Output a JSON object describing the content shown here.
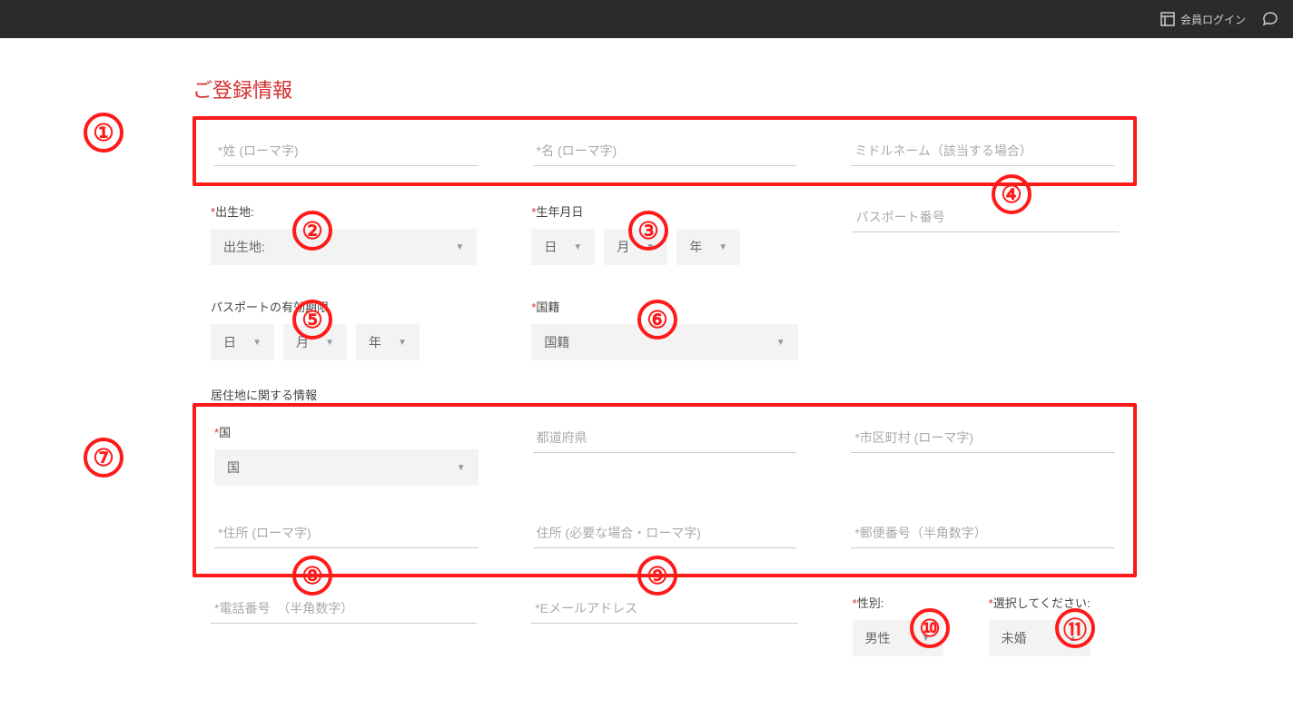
{
  "header": {
    "login_label": "会員ログイン"
  },
  "title": "ご登録情報",
  "fields": {
    "surname_ph": "*姓 (ローマ字)",
    "given_ph": "*名 (ローマ字)",
    "middle_ph": "ミドルネーム（該当する場合）",
    "birthplace_label": "出生地:",
    "birthplace_ph": "出生地:",
    "dob_label": "生年月日",
    "day": "日",
    "month": "月",
    "year": "年",
    "passport_ph": "パスポート番号",
    "passport_exp_label": "パスポートの有効期限",
    "nationality_label": "国籍",
    "nationality_ph": "国籍",
    "residence_heading": "居住地に関する情報",
    "country_label": "国",
    "country_ph": "国",
    "prefecture_ph": "都道府県",
    "city_ph": "*市区町村 (ローマ字)",
    "address_ph": "*住所 (ローマ字)",
    "address2_ph": "住所 (必要な場合・ローマ字)",
    "postal_ph": "*郵便番号（半角数字）",
    "phone_ph": "*電話番号  （半角数字）",
    "email_ph": "*Eメールアドレス",
    "gender_label": "性別:",
    "gender_value": "男性",
    "marital_label": "選択してください:",
    "marital_value": "未婚"
  },
  "annotations": {
    "a1": "①",
    "a2": "②",
    "a3": "③",
    "a4": "④",
    "a5": "⑤",
    "a6": "⑥",
    "a7": "⑦",
    "a8": "⑧",
    "a9": "⑨",
    "a10": "⑩",
    "a11": "⑪"
  }
}
